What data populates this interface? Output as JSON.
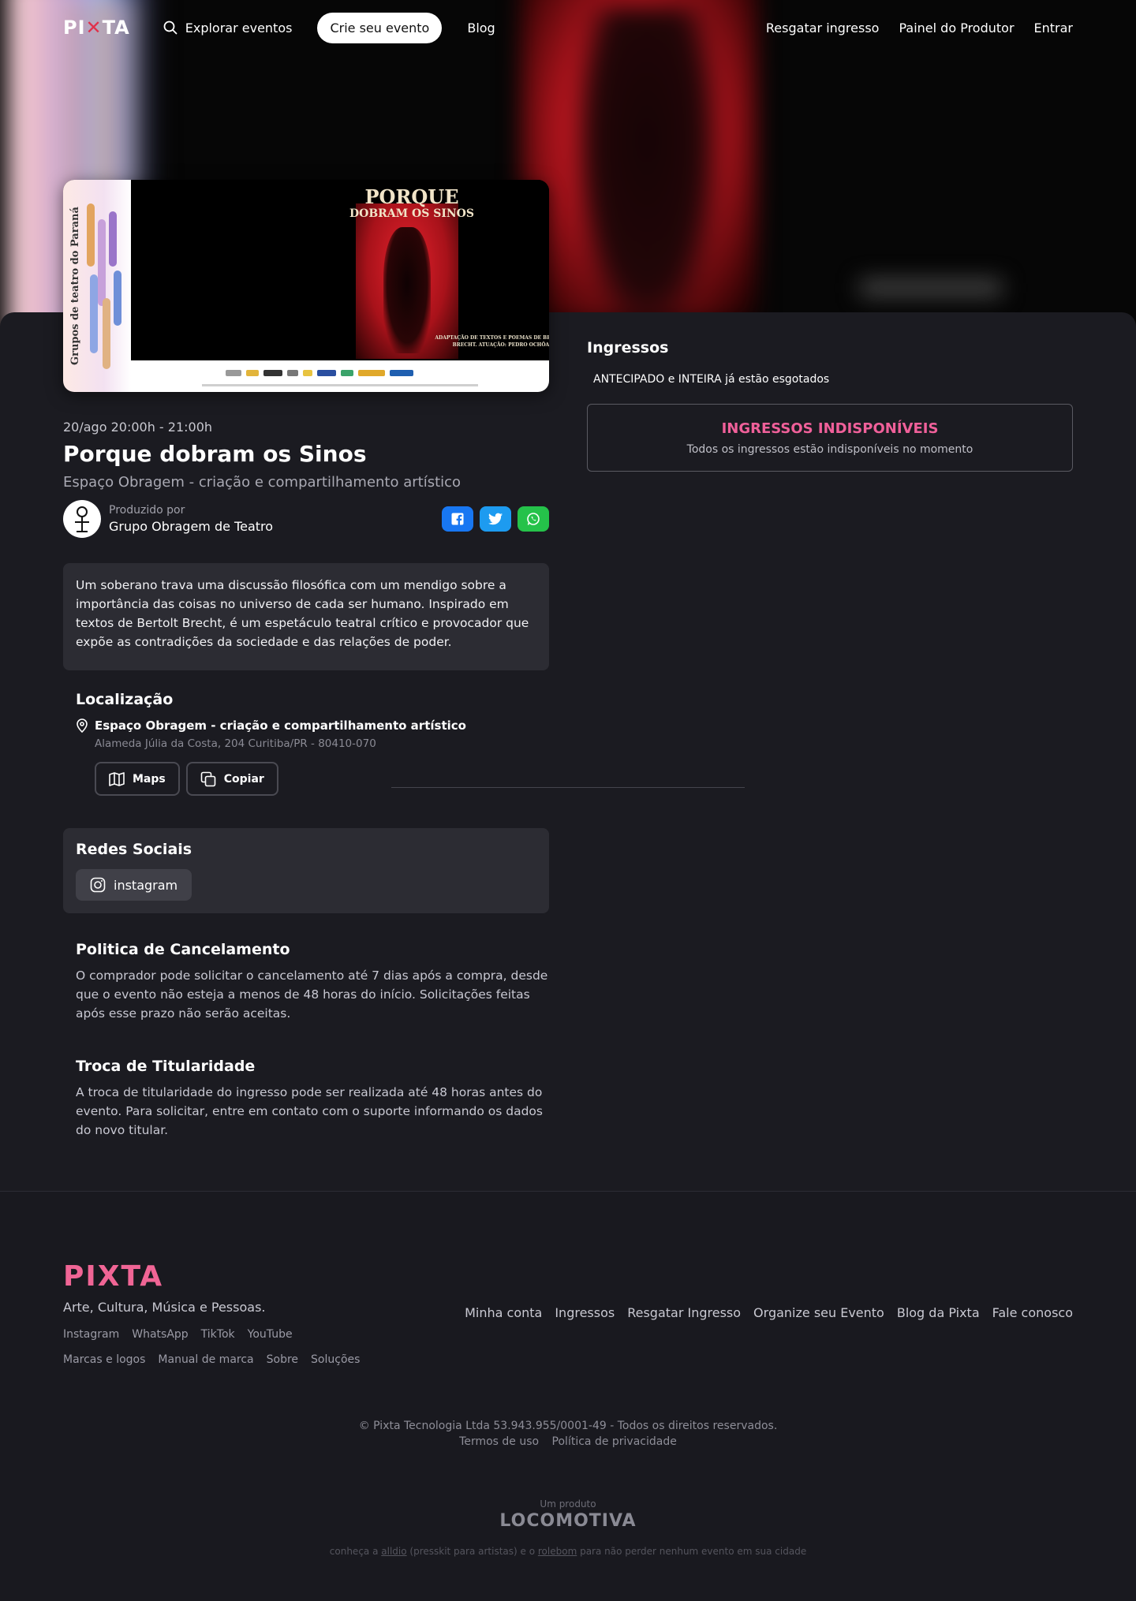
{
  "nav": {
    "logo": "PIXTA",
    "explore": "Explorar eventos",
    "create": "Crie seu evento",
    "blog": "Blog",
    "redeem": "Resgatar ingresso",
    "producer_panel": "Painel do Produtor",
    "login": "Entrar"
  },
  "banner": {
    "title_line1": "PORQUE",
    "title_line2": "DOBRAM OS SINOS",
    "credit": "ADAPTAÇÃO DE TEXTOS E POEMAS DE BERTOLT BRECHT. ATUAÇÃO: PEDRO OCHÔA.",
    "side_text": "Grupos de teatro do Paraná"
  },
  "event": {
    "date": "20/ago 20:00h - 21:00h",
    "title": "Porque dobram os Sinos",
    "venue": "Espaço Obragem - criação e compartilhamento artístico",
    "producer_label": "Produzido por",
    "producer_name": "Grupo Obragem de Teatro",
    "description": "Um soberano trava uma discussão filosófica com um mendigo sobre a importância das coisas no universo de cada ser humano. Inspirado em textos de Bertolt Brecht, é um espetáculo teatral crítico e provocador que expõe as contradições da sociedade e das relações de poder."
  },
  "share": {
    "facebook_color": "#1877f2",
    "twitter_color": "#1d9bf0",
    "whatsapp_color": "#25c24a"
  },
  "location": {
    "title": "Localização",
    "name": "Espaço Obragem - criação e compartilhamento artístico",
    "address": "Alameda Júlia da Costa, 204 Curitiba/PR - 80410-070",
    "maps_label": "Maps",
    "copy_label": "Copiar"
  },
  "social": {
    "title": "Redes Sociais",
    "instagram_label": "instagram"
  },
  "policy": {
    "title": "Politica de Cancelamento",
    "text": "O comprador pode solicitar o cancelamento até 7 dias após a compra, desde que o evento não esteja a menos de 48 horas do início. Solicitações feitas após esse prazo não serão aceitas."
  },
  "transfer": {
    "title": "Troca de Titularidade",
    "text": "A troca de titularidade do ingresso pode ser realizada até 48 horas antes do evento. Para solicitar, entre em contato com o suporte informando os dados do novo titular."
  },
  "tickets": {
    "title": "Ingressos",
    "sold_out_note": "ANTECIPADO e INTEIRA já estão esgotados",
    "unavailable_title": "INGRESSOS INDISPONÍVEIS",
    "unavailable_sub": "Todos os ingressos estão indisponíveis no momento"
  },
  "footer": {
    "logo": "PIXTA",
    "tagline": "Arte, Cultura, Música e Pessoas.",
    "social_links": [
      "Instagram",
      "WhatsApp",
      "TikTok",
      "YouTube"
    ],
    "brand_links": [
      "Marcas e logos",
      "Manual de marca",
      "Sobre",
      "Soluções"
    ],
    "nav_links": [
      "Minha conta",
      "Ingressos",
      "Resgatar Ingresso",
      "Organize seu Evento",
      "Blog da Pixta",
      "Fale conosco"
    ],
    "copyright": "© Pixta Tecnologia Ltda 53.943.955/0001-49 - Todos os direitos reservados.",
    "terms": "Termos de uso",
    "privacy": "Política de privacidade",
    "product_label": "Um produto",
    "product_name": "LOCOMOTIVA",
    "note_prefix": "conheça a ",
    "note_link1": "alldio",
    "note_middle": " (presskit para artistas) e o ",
    "note_link2": "rolebom",
    "note_suffix": " para não perder nenhum evento em sua cidade"
  },
  "colors": {
    "brand_pink": "#f06595",
    "background": "#1b1b21",
    "card": "#2c2c33"
  }
}
